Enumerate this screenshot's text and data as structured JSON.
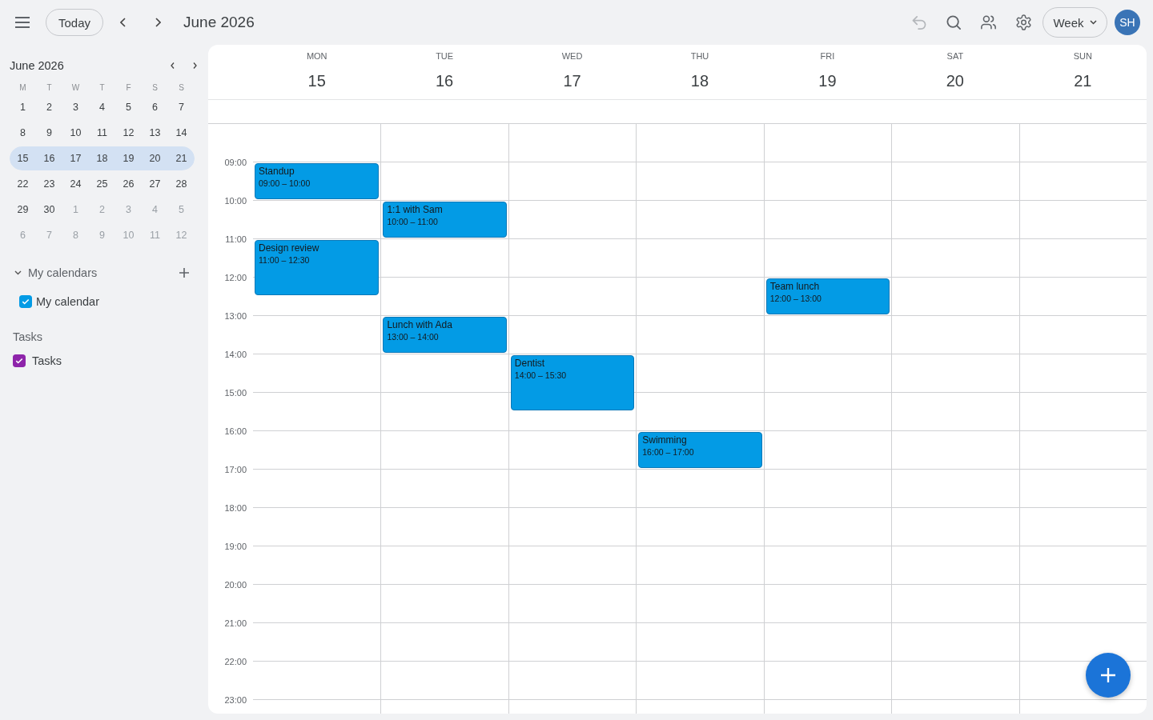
{
  "top_bar": {
    "today_button": "Today",
    "title": "June 2026",
    "undo_button": {
      "disabled": true
    },
    "view_menu": "Week",
    "avatar": "SH"
  },
  "mini_calendar": {
    "title": "June 2026",
    "weekdays": [
      "M",
      "T",
      "W",
      "T",
      "F",
      "S",
      "S"
    ],
    "weeks": [
      {
        "selected": false,
        "days": [
          {
            "label": "1",
            "outside_month": false
          },
          {
            "label": "2",
            "outside_month": false
          },
          {
            "label": "3",
            "outside_month": false
          },
          {
            "label": "4",
            "outside_month": false
          },
          {
            "label": "5",
            "outside_month": false
          },
          {
            "label": "6",
            "outside_month": false
          },
          {
            "label": "7",
            "outside_month": false
          }
        ]
      },
      {
        "selected": false,
        "days": [
          {
            "label": "8",
            "outside_month": false
          },
          {
            "label": "9",
            "outside_month": false
          },
          {
            "label": "10",
            "outside_month": false
          },
          {
            "label": "11",
            "outside_month": false
          },
          {
            "label": "12",
            "outside_month": false
          },
          {
            "label": "13",
            "outside_month": false
          },
          {
            "label": "14",
            "outside_month": false
          }
        ]
      },
      {
        "selected": true,
        "days": [
          {
            "label": "15",
            "outside_month": false
          },
          {
            "label": "16",
            "outside_month": false
          },
          {
            "label": "17",
            "outside_month": false
          },
          {
            "label": "18",
            "outside_month": false
          },
          {
            "label": "19",
            "outside_month": false
          },
          {
            "label": "20",
            "outside_month": false
          },
          {
            "label": "21",
            "outside_month": false
          }
        ]
      },
      {
        "selected": false,
        "days": [
          {
            "label": "22",
            "outside_month": false
          },
          {
            "label": "23",
            "outside_month": false
          },
          {
            "label": "24",
            "outside_month": false
          },
          {
            "label": "25",
            "outside_month": false
          },
          {
            "label": "26",
            "outside_month": false
          },
          {
            "label": "27",
            "outside_month": false
          },
          {
            "label": "28",
            "outside_month": false
          }
        ]
      },
      {
        "selected": false,
        "days": [
          {
            "label": "29",
            "outside_month": false
          },
          {
            "label": "30",
            "outside_month": false
          },
          {
            "label": "1",
            "outside_month": true
          },
          {
            "label": "2",
            "outside_month": true
          },
          {
            "label": "3",
            "outside_month": true
          },
          {
            "label": "4",
            "outside_month": true
          },
          {
            "label": "5",
            "outside_month": true
          }
        ]
      },
      {
        "selected": false,
        "days": [
          {
            "label": "6",
            "outside_month": true
          },
          {
            "label": "7",
            "outside_month": true
          },
          {
            "label": "8",
            "outside_month": true
          },
          {
            "label": "9",
            "outside_month": true
          },
          {
            "label": "10",
            "outside_month": true
          },
          {
            "label": "11",
            "outside_month": true
          },
          {
            "label": "12",
            "outside_month": true
          }
        ]
      }
    ]
  },
  "sidebar_sections": [
    {
      "kind": "collapsible",
      "title": "My calendars",
      "expanded": true,
      "items": [
        {
          "label": "My calendar",
          "checked": true,
          "color": "#039be5"
        }
      ]
    },
    {
      "kind": "plain",
      "title": "Tasks",
      "items": [
        {
          "label": "Tasks",
          "checked": true,
          "color": "#8e24aa"
        }
      ]
    }
  ],
  "week_view": {
    "days": [
      {
        "name": "MON",
        "date": "15",
        "events": [
          {
            "title": "Standup",
            "time": "09:00 – 10:00"
          },
          {
            "title": "Design review",
            "time": "11:00 – 12:30"
          }
        ]
      },
      {
        "name": "TUE",
        "date": "16",
        "events": [
          {
            "title": "1:1 with Sam",
            "time": "10:00 – 11:00"
          },
          {
            "title": "Lunch with Ada",
            "time": "13:00 – 14:00"
          }
        ]
      },
      {
        "name": "WED",
        "date": "17",
        "events": [
          {
            "title": "Dentist",
            "time": "14:00 – 15:30"
          }
        ]
      },
      {
        "name": "THU",
        "date": "18",
        "events": [
          {
            "title": "Swimming",
            "time": "16:00 – 17:00"
          }
        ]
      },
      {
        "name": "FRI",
        "date": "19",
        "events": [
          {
            "title": "Team lunch",
            "time": "12:00 – 13:00"
          }
        ]
      },
      {
        "name": "SAT",
        "date": "20"
      },
      {
        "name": "SUN",
        "date": "21"
      }
    ],
    "time_labels": [
      "09:00",
      "10:00",
      "11:00",
      "12:00",
      "13:00",
      "14:00",
      "15:00",
      "16:00",
      "17:00",
      "18:00",
      "19:00",
      "20:00",
      "21:00",
      "22:00",
      "23:00"
    ]
  }
}
